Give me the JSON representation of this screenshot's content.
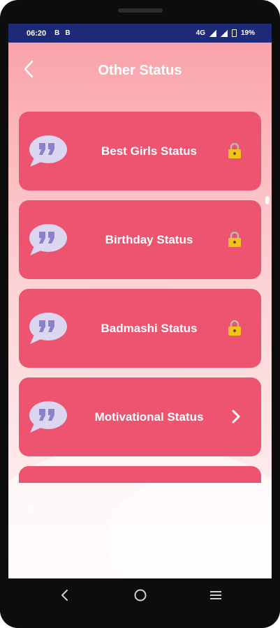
{
  "status_bar": {
    "time": "06:20",
    "notif1": "B",
    "notif2": "B",
    "network": "4G",
    "battery": "19%"
  },
  "app_bar": {
    "title": "Other Status",
    "back_icon": "chevron-left-icon"
  },
  "items": [
    {
      "label": "Best Girls Status",
      "icon": "quote-bubble-icon",
      "trailing": "lock-icon",
      "locked": true
    },
    {
      "label": "Birthday Status",
      "icon": "quote-bubble-icon",
      "trailing": "lock-icon",
      "locked": true
    },
    {
      "label": "Badmashi Status",
      "icon": "quote-bubble-icon",
      "trailing": "lock-icon",
      "locked": true
    },
    {
      "label": "Motivational Status",
      "icon": "quote-bubble-icon",
      "trailing": "chevron-right-icon",
      "locked": false
    },
    {
      "label": "",
      "icon": "",
      "trailing": "",
      "locked": false
    }
  ],
  "nav": {
    "back": "back-icon",
    "home": "home-icon",
    "recents": "recents-icon"
  },
  "colors": {
    "status_bar": "#1e2a78",
    "card": "#ec5470",
    "bubble": "#dcd6f0",
    "quote": "#8b80c9",
    "lock": "#f4c21a"
  }
}
